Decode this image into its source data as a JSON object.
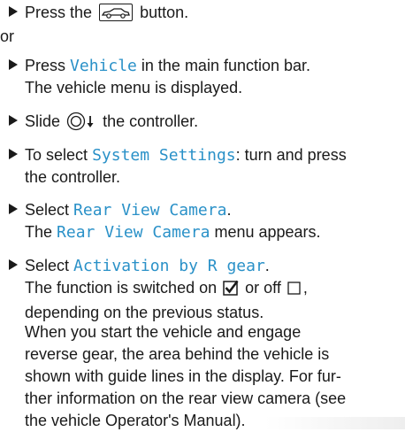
{
  "steps": [
    {
      "pre": "Press the",
      "icon": "car-button-icon",
      "post": "button."
    },
    {
      "text": "or"
    },
    {
      "pre": "Press",
      "highlight": "Vehicle",
      "post": "in the main function bar.",
      "line2": "The vehicle menu is displayed."
    },
    {
      "pre": "Slide",
      "icon": "controller-slide-down-icon",
      "post": "the controller."
    },
    {
      "pre": "To select",
      "highlight": "System Settings",
      "post": ": turn and press",
      "line2": "the controller."
    },
    {
      "pre": "Select",
      "highlight": "Rear View Camera",
      "post": ".",
      "line2_pre": "The",
      "line2_highlight": "Rear View Camera",
      "line2_post": "menu appears."
    },
    {
      "pre": "Select",
      "highlight": "Activation by R gear",
      "post": ".",
      "line2_pre": "The function is switched on",
      "line2_mid": "or off",
      "line2_post": ",",
      "line3": "depending on the previous status."
    }
  ],
  "paragraph": [
    "When you start the vehicle and engage",
    "reverse gear, the area behind the vehicle is",
    "shown with guide lines in the display. For fur-",
    "ther information on the rear view camera (see",
    "the vehicle Operator's Manual)."
  ],
  "colors": {
    "highlight": "#2a91c8",
    "text": "#1a1a1a"
  }
}
